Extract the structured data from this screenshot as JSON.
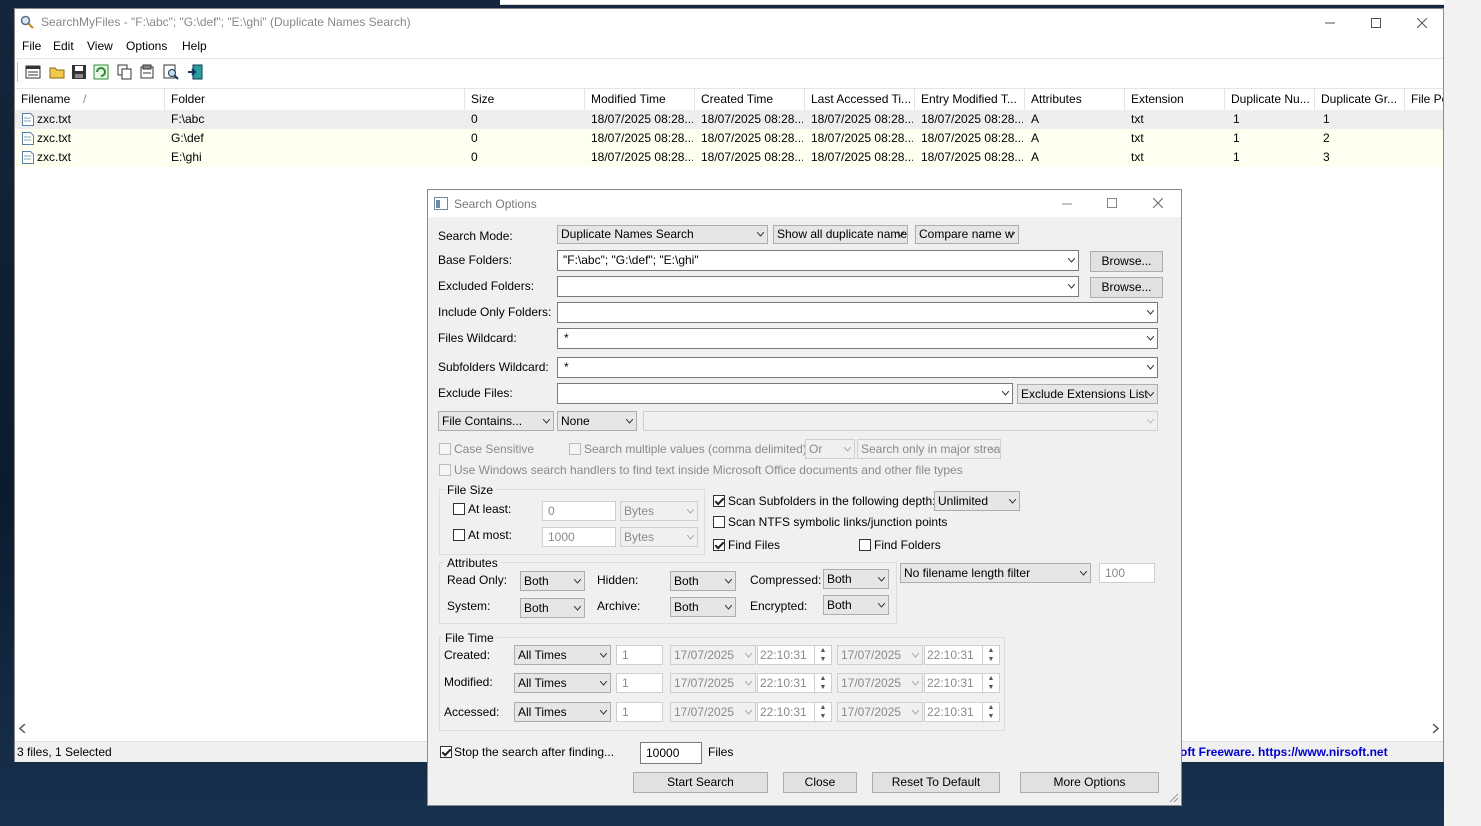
{
  "main": {
    "title": "SearchMyFiles - \"F:\\abc\"; \"G:\\def\"; \"E:\\ghi\"  (Duplicate Names Search)",
    "menu": [
      "File",
      "Edit",
      "View",
      "Options",
      "Help"
    ],
    "columns": [
      "Filename",
      "Folder",
      "Size",
      "Modified Time",
      "Created Time",
      "Last Accessed Ti...",
      "Entry Modified T...",
      "Attributes",
      "Extension",
      "Duplicate Nu...",
      "Duplicate Gr...",
      "File Po"
    ],
    "sort_indicator": "/",
    "rows": [
      [
        "zxc.txt",
        "F:\\abc",
        "0",
        "18/07/2025 08:28...",
        "18/07/2025 08:28...",
        "18/07/2025 08:28...",
        "18/07/2025 08:28...",
        "A",
        "txt",
        "1",
        "1"
      ],
      [
        "zxc.txt",
        "G:\\def",
        "0",
        "18/07/2025 08:28...",
        "18/07/2025 08:28...",
        "18/07/2025 08:28...",
        "18/07/2025 08:28...",
        "A",
        "txt",
        "1",
        "2"
      ],
      [
        "zxc.txt",
        "E:\\ghi",
        "0",
        "18/07/2025 08:28...",
        "18/07/2025 08:28...",
        "18/07/2025 08:28...",
        "18/07/2025 08:28...",
        "A",
        "txt",
        "1",
        "3"
      ]
    ],
    "status": "3 files, 1 Selected",
    "freeware": "oft Freeware. https://www.nirsoft.net"
  },
  "dialog": {
    "title": "Search Options",
    "search_mode_label": "Search Mode:",
    "search_mode": "Duplicate Names Search",
    "show_mode": "Show all duplicate name",
    "compare_mode": "Compare name w",
    "base_folders_label": "Base Folders:",
    "base_folders": "\"F:\\abc\"; \"G:\\def\"; \"E:\\ghi\"",
    "browse": "Browse...",
    "excluded_folders_label": "Excluded Folders:",
    "include_only_label": "Include Only Folders:",
    "files_wildcard_label": "Files Wildcard:",
    "files_wildcard": "*",
    "subfolders_wildcard_label": "Subfolders Wildcard:",
    "subfolders_wildcard": "*",
    "exclude_files_label": "Exclude Files:",
    "exclude_ext": "Exclude Extensions List",
    "file_contains": "File Contains...",
    "contains_mode": "None",
    "case_sensitive": "Case Sensitive",
    "search_multiple": "Search multiple values (comma delimited)",
    "or_value": "Or",
    "major_streams": "Search only in major strea",
    "windows_handlers": "Use Windows search handlers to find text inside Microsoft Office documents and other file types",
    "file_size_title": "File Size",
    "at_least": "At least:",
    "at_least_value": "0",
    "at_most": "At most:",
    "at_most_value": "1000",
    "bytes": "Bytes",
    "scan_subfolders": "Scan Subfolders in the following depth:",
    "depth": "Unlimited",
    "scan_ntfs": "Scan NTFS symbolic links/junction points",
    "find_files": "Find Files",
    "find_folders": "Find Folders",
    "attributes_title": "Attributes",
    "read_only": "Read Only:",
    "hidden": "Hidden:",
    "compressed": "Compressed:",
    "system": "System:",
    "archive": "Archive:",
    "encrypted": "Encrypted:",
    "both": "Both",
    "filename_length": "No filename length filter",
    "filename_length_value": "100",
    "file_time_title": "File Time",
    "created": "Created:",
    "modified": "Modified:",
    "accessed": "Accessed:",
    "all_times": "All Times",
    "one": "1",
    "date": "17/07/2025",
    "time": "22:10:31",
    "stop_search": "Stop the search after finding...",
    "stop_count": "10000",
    "files_unit": "Files",
    "start_search": "Start Search",
    "close": "Close",
    "reset": "Reset To Default",
    "more_options": "More Options"
  }
}
